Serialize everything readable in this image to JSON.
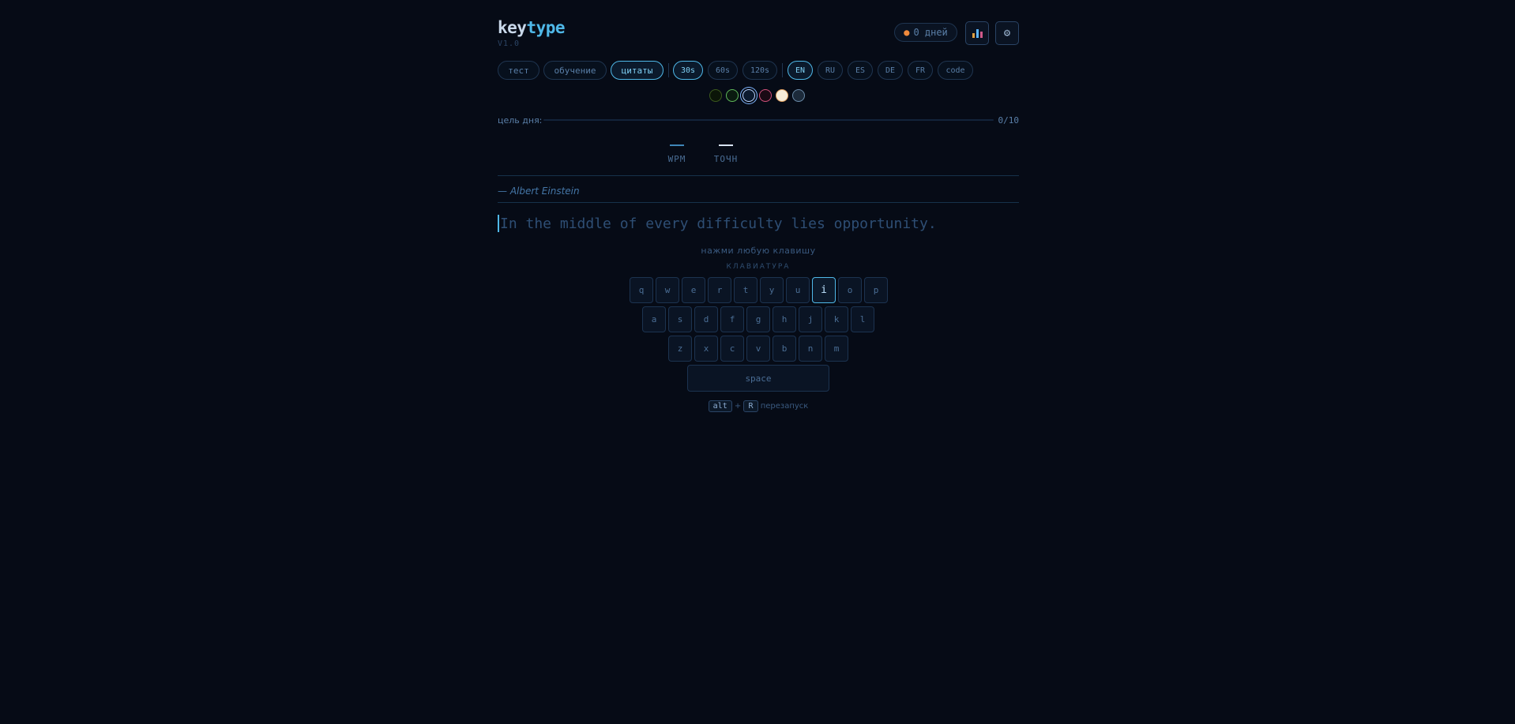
{
  "header": {
    "logo_part1": "key",
    "logo_part2": "type",
    "version": "V1.0",
    "streak_label": "0 дней"
  },
  "modes": [
    {
      "label": "тест",
      "active": false
    },
    {
      "label": "обучение",
      "active": false
    },
    {
      "label": "цитаты",
      "active": true
    }
  ],
  "durations": [
    {
      "label": "30s",
      "active": true
    },
    {
      "label": "60s",
      "active": false
    },
    {
      "label": "120s",
      "active": false
    }
  ],
  "languages": [
    {
      "label": "EN",
      "active": true
    },
    {
      "label": "RU",
      "active": false
    },
    {
      "label": "ES",
      "active": false
    },
    {
      "label": "DE",
      "active": false
    },
    {
      "label": "FR",
      "active": false
    },
    {
      "label": "code",
      "active": false
    }
  ],
  "themes": [
    {
      "fill": "#0b1508",
      "border": "#3c5a1e"
    },
    {
      "fill": "#0a1a10",
      "border": "#5fb85a"
    },
    {
      "fill": "#0c1a2e",
      "border": "#b8d4ff",
      "active": true
    },
    {
      "fill": "#1a0a14",
      "border": "#d0507a"
    },
    {
      "fill": "#f6ecd8",
      "border": "#e0a060"
    },
    {
      "fill": "#1c2a3a",
      "border": "#6a8aa8"
    }
  ],
  "goal": {
    "label": "цель дня:",
    "count": "0/10",
    "progress": 0
  },
  "stats": {
    "wpm_label": "WPM",
    "acc_label": "ТОЧН"
  },
  "quote": {
    "author": "— Albert Einstein",
    "text": "In the middle of every difficulty lies opportunity."
  },
  "hints": {
    "press_any": "нажми любую клавишу",
    "keyboard_title": "КЛАВИАТУРА",
    "restart_mod": "alt",
    "restart_key": "R",
    "restart_plus": "+",
    "restart_label": "перезапуск"
  },
  "keyboard": {
    "row1": [
      "q",
      "w",
      "e",
      "r",
      "t",
      "y",
      "u",
      "i",
      "o",
      "p"
    ],
    "row2": [
      "a",
      "s",
      "d",
      "f",
      "g",
      "h",
      "j",
      "k",
      "l"
    ],
    "row3": [
      "z",
      "x",
      "c",
      "v",
      "b",
      "n",
      "m"
    ],
    "space_label": "space",
    "highlighted": "i"
  },
  "colors": {
    "accent": "#4fb8e8",
    "background": "#060b16"
  }
}
